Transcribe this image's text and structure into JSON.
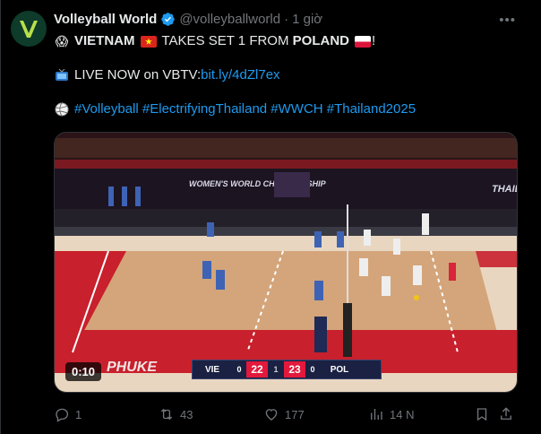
{
  "author": {
    "name": "Volleyball World",
    "handle": "@volleyballworld",
    "separator": "·",
    "time": "1 giờ"
  },
  "tweet": {
    "emoji_shocked": "😱",
    "team_a": "VIETNAM",
    "middle": "TAKES SET 1 FROM",
    "team_b": "POLAND",
    "exclaim": "!",
    "tv_emoji": "📺",
    "live_prefix": "LIVE NOW on VBTV: ",
    "live_link": "bit.ly/4dZl7ex",
    "ball_emoji": "🏐",
    "hashtags": "#Volleyball #ElectrifyingThailand #WWCH #Thailand2025"
  },
  "video": {
    "duration": "0:10",
    "scoreboard": {
      "team_a": "VIE",
      "sets_a": "0",
      "points_a": "22",
      "team_b": "POL",
      "sets_b": "0",
      "points_b": "23",
      "set_indicator": "1"
    },
    "banner_text": "WOMEN'S WORLD CHAMPIONSHIP",
    "banner_right": "THAIL",
    "floor_text": "PHUKE"
  },
  "actions": {
    "replies": "1",
    "reposts": "43",
    "likes": "177",
    "views": "14 N"
  },
  "colors": {
    "background": "#000000",
    "link": "#1d9bf0",
    "muted": "#71767b",
    "verified": "#1d9bf0",
    "court_red": "#c8202c",
    "court_tan": "#d9b98c"
  }
}
